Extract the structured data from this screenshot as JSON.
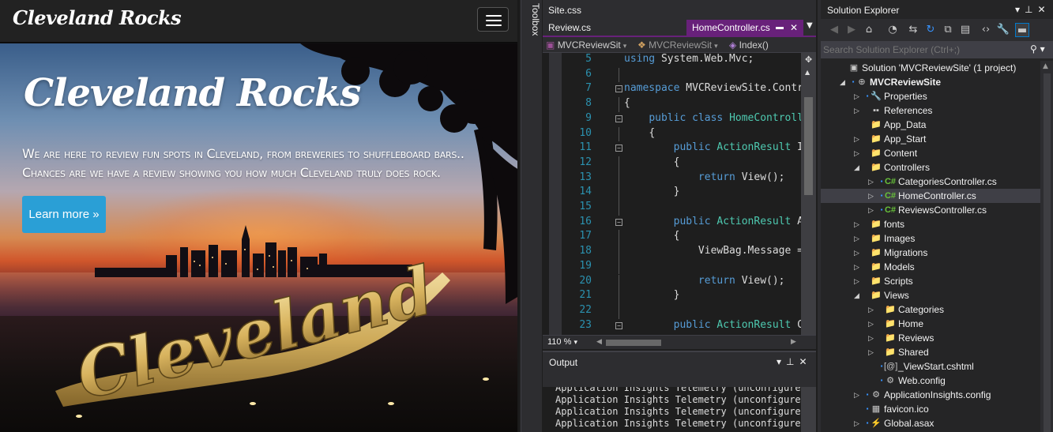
{
  "browser": {
    "brand": "Cleveland Rocks",
    "hero_title": "Cleveland Rocks",
    "hero_lead": "We are here to review fun spots in Cleveland, from breweries to shuffleboard bars.. Chances are we have a review showing you how much Cleveland truly does rock.",
    "learn_more": "Learn more »",
    "sign_text": "Cleveland"
  },
  "toolbox": {
    "label": "Toolbox"
  },
  "editor": {
    "tabs": {
      "site": "Site.css",
      "review": "Review.cs",
      "home": "HomeController.cs"
    },
    "nav": {
      "project": "MVCReviewSit",
      "class": "MVCReviewSit",
      "member": "Index()"
    },
    "zoom": "110 %",
    "lines": [
      {
        "n": "5",
        "code": "using System.Web.Mvc;"
      },
      {
        "n": "6",
        "code": ""
      },
      {
        "n": "7",
        "code": "namespace MVCReviewSite.Contr"
      },
      {
        "n": "8",
        "code": "{"
      },
      {
        "n": "9",
        "code": "    public class HomeControll"
      },
      {
        "n": "10",
        "code": "    {"
      },
      {
        "n": "11",
        "code": "        public ActionResult I"
      },
      {
        "n": "12",
        "code": "        {"
      },
      {
        "n": "13",
        "code": "            return View();"
      },
      {
        "n": "14",
        "code": "        }"
      },
      {
        "n": "15",
        "code": ""
      },
      {
        "n": "16",
        "code": "        public ActionResult A"
      },
      {
        "n": "17",
        "code": "        {"
      },
      {
        "n": "18",
        "code": "            ViewBag.Message ="
      },
      {
        "n": "19",
        "code": ""
      },
      {
        "n": "20",
        "code": "            return View();"
      },
      {
        "n": "21",
        "code": "        }"
      },
      {
        "n": "22",
        "code": ""
      },
      {
        "n": "23",
        "code": "        public ActionResult C"
      }
    ]
  },
  "output": {
    "title": "Output",
    "lines": [
      "Application Insights Telemetry (unconfigured)",
      "Application Insights Telemetry (unconfigured)",
      "Application Insights Telemetry (unconfigured)",
      "Application Insights Telemetry (unconfigured)"
    ]
  },
  "solution_explorer": {
    "title": "Solution Explorer",
    "search_placeholder": "Search Solution Explorer (Ctrl+;)",
    "nodes": [
      {
        "label": "Solution 'MVCReviewSite' (1 project)",
        "icon": "solution-icon"
      },
      {
        "label": "MVCReviewSite",
        "icon": "web-project-icon"
      },
      {
        "label": "Properties",
        "icon": "wrench-icon"
      },
      {
        "label": "References",
        "icon": "references-icon"
      },
      {
        "label": "App_Data",
        "icon": "folder-icon"
      },
      {
        "label": "App_Start",
        "icon": "folder-icon"
      },
      {
        "label": "Content",
        "icon": "folder-icon"
      },
      {
        "label": "Controllers",
        "icon": "folder-icon"
      },
      {
        "label": "CategoriesController.cs",
        "icon": "csharp-file-icon"
      },
      {
        "label": "HomeController.cs",
        "icon": "csharp-file-icon"
      },
      {
        "label": "ReviewsController.cs",
        "icon": "csharp-file-icon"
      },
      {
        "label": "fonts",
        "icon": "folder-icon"
      },
      {
        "label": "Images",
        "icon": "folder-icon"
      },
      {
        "label": "Migrations",
        "icon": "folder-icon"
      },
      {
        "label": "Models",
        "icon": "folder-icon"
      },
      {
        "label": "Scripts",
        "icon": "folder-icon"
      },
      {
        "label": "Views",
        "icon": "folder-icon"
      },
      {
        "label": "Categories",
        "icon": "folder-icon"
      },
      {
        "label": "Home",
        "icon": "folder-icon"
      },
      {
        "label": "Reviews",
        "icon": "folder-icon"
      },
      {
        "label": "Shared",
        "icon": "folder-icon"
      },
      {
        "label": "_ViewStart.cshtml",
        "icon": "razor-file-icon"
      },
      {
        "label": "Web.config",
        "icon": "config-file-icon"
      },
      {
        "label": "ApplicationInsights.config",
        "icon": "config-file-icon"
      },
      {
        "label": "favicon.ico",
        "icon": "image-file-icon"
      },
      {
        "label": "Global.asax",
        "icon": "asax-file-icon"
      }
    ]
  },
  "colors": {
    "accent_purple": "#68217a",
    "button_blue": "#2a9fd6",
    "keyword_blue": "#569cd6",
    "type_teal": "#4ec9b0",
    "line_number": "#2b91af"
  }
}
